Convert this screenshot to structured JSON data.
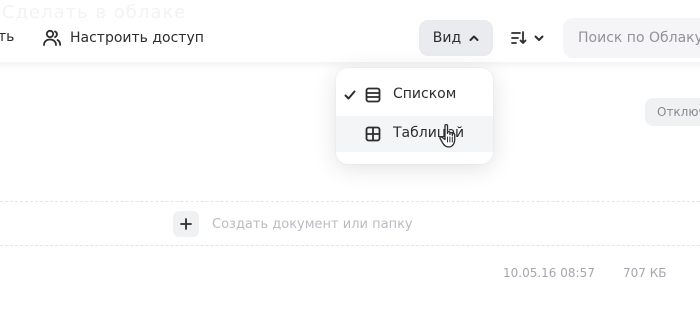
{
  "header": {
    "ghost_title": "Сделать в облаке",
    "cut_action_label": "ть",
    "share_button_label": "Настроить доступ",
    "view_button_label": "Вид",
    "search_placeholder": "Поиск по Облаку"
  },
  "view_menu": {
    "items": [
      {
        "label": "Списком",
        "selected": true,
        "icon": "list-view-icon"
      },
      {
        "label": "Таблицей",
        "selected": false,
        "icon": "grid-view-icon"
      }
    ]
  },
  "content": {
    "disabled_badge": "Отключ",
    "create_label": "Создать документ или папку",
    "file_date": "10.05.16 08:57",
    "file_size": "707 КБ"
  },
  "colors": {
    "text": "#2c2d2e",
    "muted": "#919399",
    "button_bg": "#eaebee",
    "search_bg": "#f5f5f7"
  }
}
